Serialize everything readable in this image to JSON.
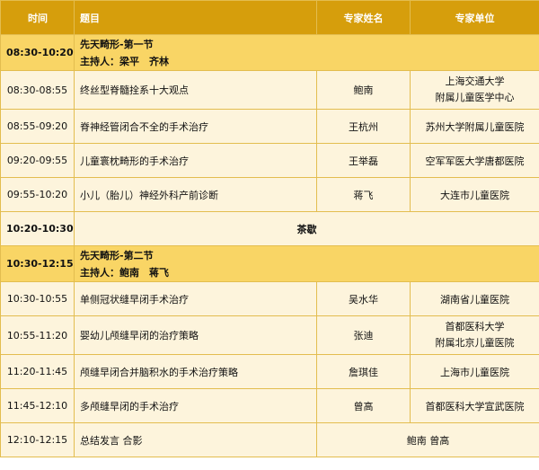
{
  "header": {
    "time": "时间",
    "title": "题目",
    "expert": "专家姓名",
    "unit": "专家单位"
  },
  "sections": [
    {
      "time": "08:30-10:20",
      "title": "先天畸形-第一节",
      "host": "主持人：梁平　齐林"
    },
    {
      "time": "10:30-12:15",
      "title": "先天畸形-第二节",
      "host": "主持人：鲍南　蒋飞"
    }
  ],
  "rows1": [
    {
      "time": "08:30-08:55",
      "title": "终丝型脊髓拴系十大观点",
      "expert": "鲍南",
      "unit_l1": "上海交通大学",
      "unit_l2": "附属儿童医学中心"
    },
    {
      "time": "08:55-09:20",
      "title": "脊神经管闭合不全的手术治疗",
      "expert": "王杭州",
      "unit": "苏州大学附属儿童医院"
    },
    {
      "time": "09:20-09:55",
      "title": "儿童寰枕畸形的手术治疗",
      "expert": "王举磊",
      "unit": "空军军医大学唐都医院"
    },
    {
      "time": "09:55-10:20",
      "title": "小儿（胎儿）神经外科产前诊断",
      "expert": "蒋飞",
      "unit": "大连市儿童医院"
    }
  ],
  "break": {
    "time": "10:20-10:30",
    "label": "茶歇"
  },
  "rows2": [
    {
      "time": "10:30-10:55",
      "title": "单侧冠状缝早闭手术治疗",
      "expert": "吴水华",
      "unit": "湖南省儿童医院"
    },
    {
      "time": "10:55-11:20",
      "title": "婴幼儿颅缝早闭的治疗策略",
      "expert": "张迪",
      "unit_l1": "首都医科大学",
      "unit_l2": "附属北京儿童医院"
    },
    {
      "time": "11:20-11:45",
      "title": "颅缝早闭合并脑积水的手术治疗策略",
      "expert": "詹琪佳",
      "unit": "上海市儿童医院"
    },
    {
      "time": "11:45-12:10",
      "title": "多颅缝早闭的手术治疗",
      "expert": "曾高",
      "unit": "首都医科大学宣武医院"
    }
  ],
  "closing": {
    "time": "12:10-12:15",
    "title": "总结发言  合影",
    "experts": "鲍南  曾高"
  },
  "colors": {
    "header": "#d69e0c",
    "section": "#f9d565",
    "row": "#fdf4dc",
    "border": "#e3bd4f"
  }
}
